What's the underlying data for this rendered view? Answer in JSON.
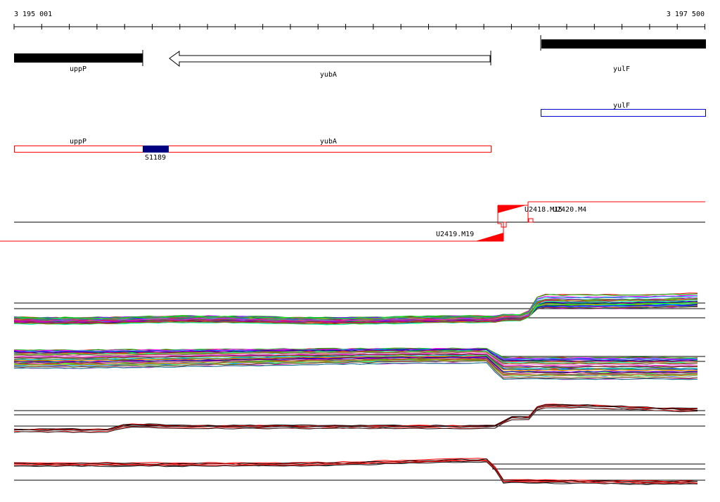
{
  "ruler": {
    "start_label": "3 195 001",
    "end_label": "3 197 500"
  },
  "genes": {
    "upp_p": "uppP",
    "yub_a": "yubA",
    "yul_f": "yulF"
  },
  "annotation_track": {
    "yul_f": "yulF",
    "upp_p": "uppP",
    "yub_a": "yubA",
    "segment_label": "S1189"
  },
  "transcription_units": {
    "u2418": "U2418.M15",
    "u2420": "U2420.M4",
    "u2419": "U2419.M19"
  },
  "colors": {
    "forward_feature": "#000000",
    "reverse_feature": "#ffffff",
    "annotation_outline_red": "#ff0000",
    "annotation_outline_blue": "#0000cc",
    "segment_fill": "#000080",
    "tu_marker": "#ff0000"
  },
  "expression_panels": [
    "multi-condition-forward",
    "multi-condition-reverse",
    "replicate-forward",
    "replicate-reverse"
  ]
}
